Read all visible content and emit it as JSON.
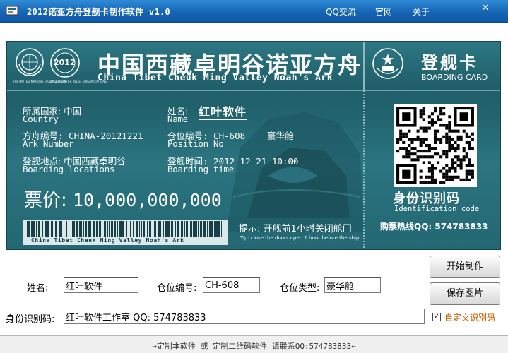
{
  "window": {
    "title": "2012诺亚方舟登舰卡制作软件 v1.0",
    "menu": [
      "QQ交流",
      "官网",
      "关于"
    ],
    "minimize": "—",
    "close": "✕"
  },
  "ticket": {
    "title_cn": "中国西藏卓明谷诺亚方舟",
    "title_en": "China Tibet Cheuk Ming Valley Noah’s Ark",
    "org_text_1": "THE UNITED NATIONS ORGANIZATION",
    "org_text_2": "2012 DISASTER RELIEF ORGANIZATIONS",
    "logo_2012": "2012",
    "boarding_cn": "登舰卡",
    "boarding_en": "BOARDING CARD",
    "country_cn": "所属国家: 中国",
    "country_en": "Country",
    "name_cn": "姓名:",
    "name_value": "红叶软件",
    "name_en": "Name",
    "ark_cn": "方舟编号: CHINA-20121221",
    "ark_en": "Ark Number",
    "position_cn": "仓位编号: CH-608",
    "position_type": "豪华舱",
    "position_en": "Position No",
    "location_cn": "登舰地点: 中国西藏卓明谷",
    "location_en": "Boarding locations",
    "time_cn": "登舰时间: 2012-12-21 10:00",
    "time_en": "Boarding time",
    "price_label": "票价:",
    "price_value": "10,000,000,000",
    "id_cn": "身份识别码",
    "id_en": "Identification code",
    "hotline": "购票热线QQ: 574783833",
    "barcode_text": "China Tibet Cheuk Ming Valley Noah’s Ark",
    "tip_cn": "提示: 开舰前1小时关闭舱门",
    "tip_en": "Tip: close the doors open 1 hour before the ship"
  },
  "form": {
    "name_label": "姓名:",
    "name_value": "红叶软件",
    "position_label": "仓位编号:",
    "position_value": "CH-608",
    "type_label": "仓位类型:",
    "type_value": "豪华舱",
    "id_label": "身份识别码:",
    "id_value": "红叶软件工作室 QQ: 574783833",
    "start_button": "开始制作",
    "save_button": "保存图片",
    "custom_id_label": "自定义识别码",
    "custom_id_checked": true
  },
  "status": "→定制本软件 或 定制二维码软件 请联系QQ:574783833←",
  "colors": {
    "title_bar": "#1565b5",
    "ticket_bg": "#27707a",
    "checkbox_label": "#c06000"
  }
}
